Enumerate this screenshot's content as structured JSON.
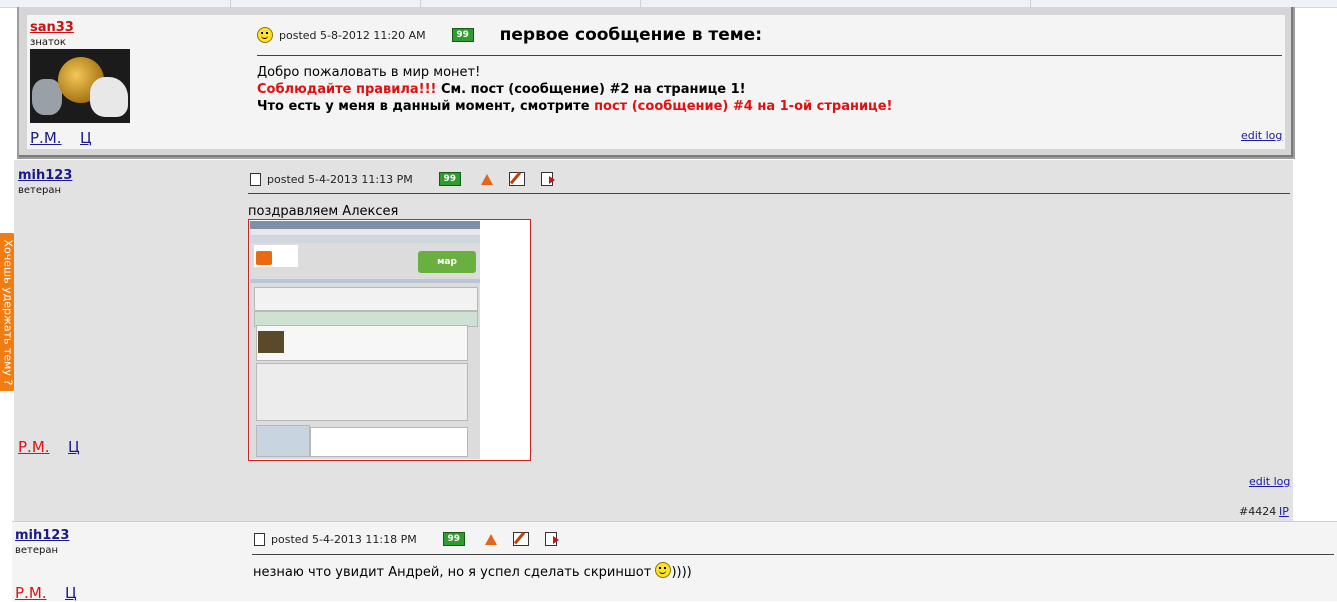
{
  "side_tab": {
    "label": "Хочешь удержать тему ?"
  },
  "posts": [
    {
      "user": "san33",
      "rank": "знаток",
      "posted": "posted 5-8-2012 11:20 AM",
      "title": "первое сообщение в теме:",
      "lines": [
        {
          "parts": [
            "Добро пожаловать в мир монет!"
          ]
        },
        {
          "parts": [
            "Соблюдайте правила!!!",
            " См. пост (сообщение) #2 на странице 1!"
          ]
        },
        {
          "parts": [
            "Что есть у меня в данный момент, смотрите ",
            "пост (сообщение) #4 на 1-ой странице!"
          ]
        }
      ],
      "pm": "Р.М.",
      "c": "Ц",
      "edit_log": "edit log",
      "quote_icon_label": "99"
    },
    {
      "user": "mih123",
      "rank": "ветеран",
      "posted": "posted 5-4-2013 11:13 PM",
      "text": "поздравляем Алексея",
      "pm": "Р.М.",
      "c": "Ц",
      "edit_log": "edit log",
      "post_number": "#4424",
      "ip": "IP",
      "quote_icon_label": "99"
    },
    {
      "user": "mih123",
      "rank": "ветеран",
      "posted": "posted 5-4-2013 11:18 PM",
      "text_before": "незнаю что увидит Андрей, но я успел сделать скриншот",
      "text_after": "))))",
      "pm": "Р.М.",
      "c": "Ц",
      "quote_icon_label": "99"
    }
  ],
  "colors": {
    "username_1": "#cc1111",
    "username_other": "#1a1a8c",
    "red_text": "#e01010",
    "pm_red": "#dd1111",
    "link": "#1a1aa0",
    "side_tab": "#f07c12"
  }
}
